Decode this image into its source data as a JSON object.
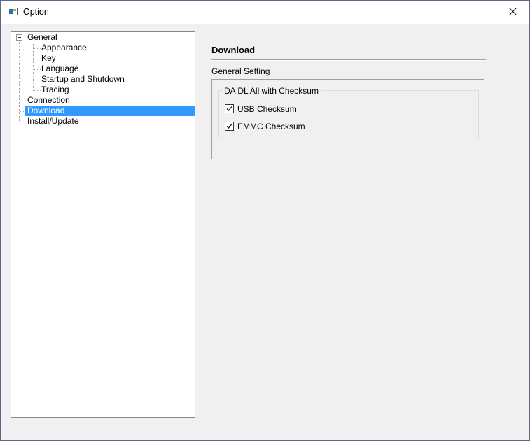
{
  "window": {
    "title": "Option",
    "icon": "app-window-icon",
    "close_icon": "close-icon"
  },
  "tree": {
    "items": [
      {
        "label": "General",
        "expanded": true
      },
      {
        "label": "Appearance"
      },
      {
        "label": "Key"
      },
      {
        "label": "Language"
      },
      {
        "label": "Startup and Shutdown"
      },
      {
        "label": "Tracing"
      },
      {
        "label": "Connection"
      },
      {
        "label": "Download",
        "selected": true
      },
      {
        "label": "Install/Update"
      }
    ]
  },
  "panel": {
    "title": "Download",
    "section": "General Setting",
    "group": {
      "legend": "DA DL All with Checksum",
      "options": [
        {
          "label": "USB Checksum",
          "checked": true
        },
        {
          "label": "EMMC Checksum",
          "checked": true
        }
      ]
    }
  },
  "colors": {
    "selection": "#3399ff",
    "window_bg": "#f0f0f0"
  }
}
